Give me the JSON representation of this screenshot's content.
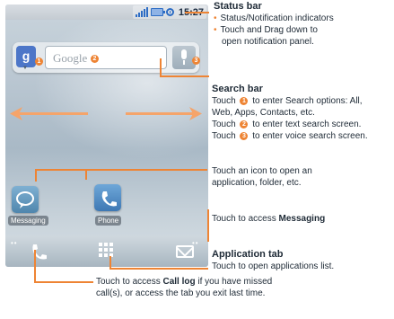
{
  "phone": {
    "status_time": "15:27",
    "search": {
      "placeholder_logo": "Google",
      "g_label": "g",
      "callouts": [
        "1",
        "2",
        "3"
      ]
    },
    "icons": {
      "messaging_label": "Messaging",
      "phone_label": "Phone"
    }
  },
  "annotations": {
    "status_bar": {
      "title": "Status bar",
      "lines": [
        "Status/Notification indicators",
        "Touch and Drag down to",
        "open notification panel."
      ]
    },
    "search_bar": {
      "title": "Search bar",
      "line1": "to enter Search options: All,",
      "line2": "Web, Apps, Contacts, etc.",
      "line3": "to enter text search screen.",
      "line4": "to enter voice search screen.",
      "touch": "Touch"
    },
    "icon_note": {
      "line1": "Touch an icon to open an",
      "line2": "application, folder, etc."
    },
    "messaging_note": {
      "prefix": "Touch to access",
      "bold": "Messaging"
    },
    "application_tab": {
      "title": "Application tab",
      "line": "Touch to open applications list."
    },
    "call_log": {
      "prefix": "Touch to access",
      "bold": "Call log",
      "suffix": "if you have missed",
      "line2": "call(s), or access the tab you exit last time."
    }
  },
  "colors": {
    "accent": "#ee8434",
    "status_icons": "#2d6cc4",
    "messaging_icon": "#5a8fb3",
    "phone_icon": "#4a87c2"
  }
}
